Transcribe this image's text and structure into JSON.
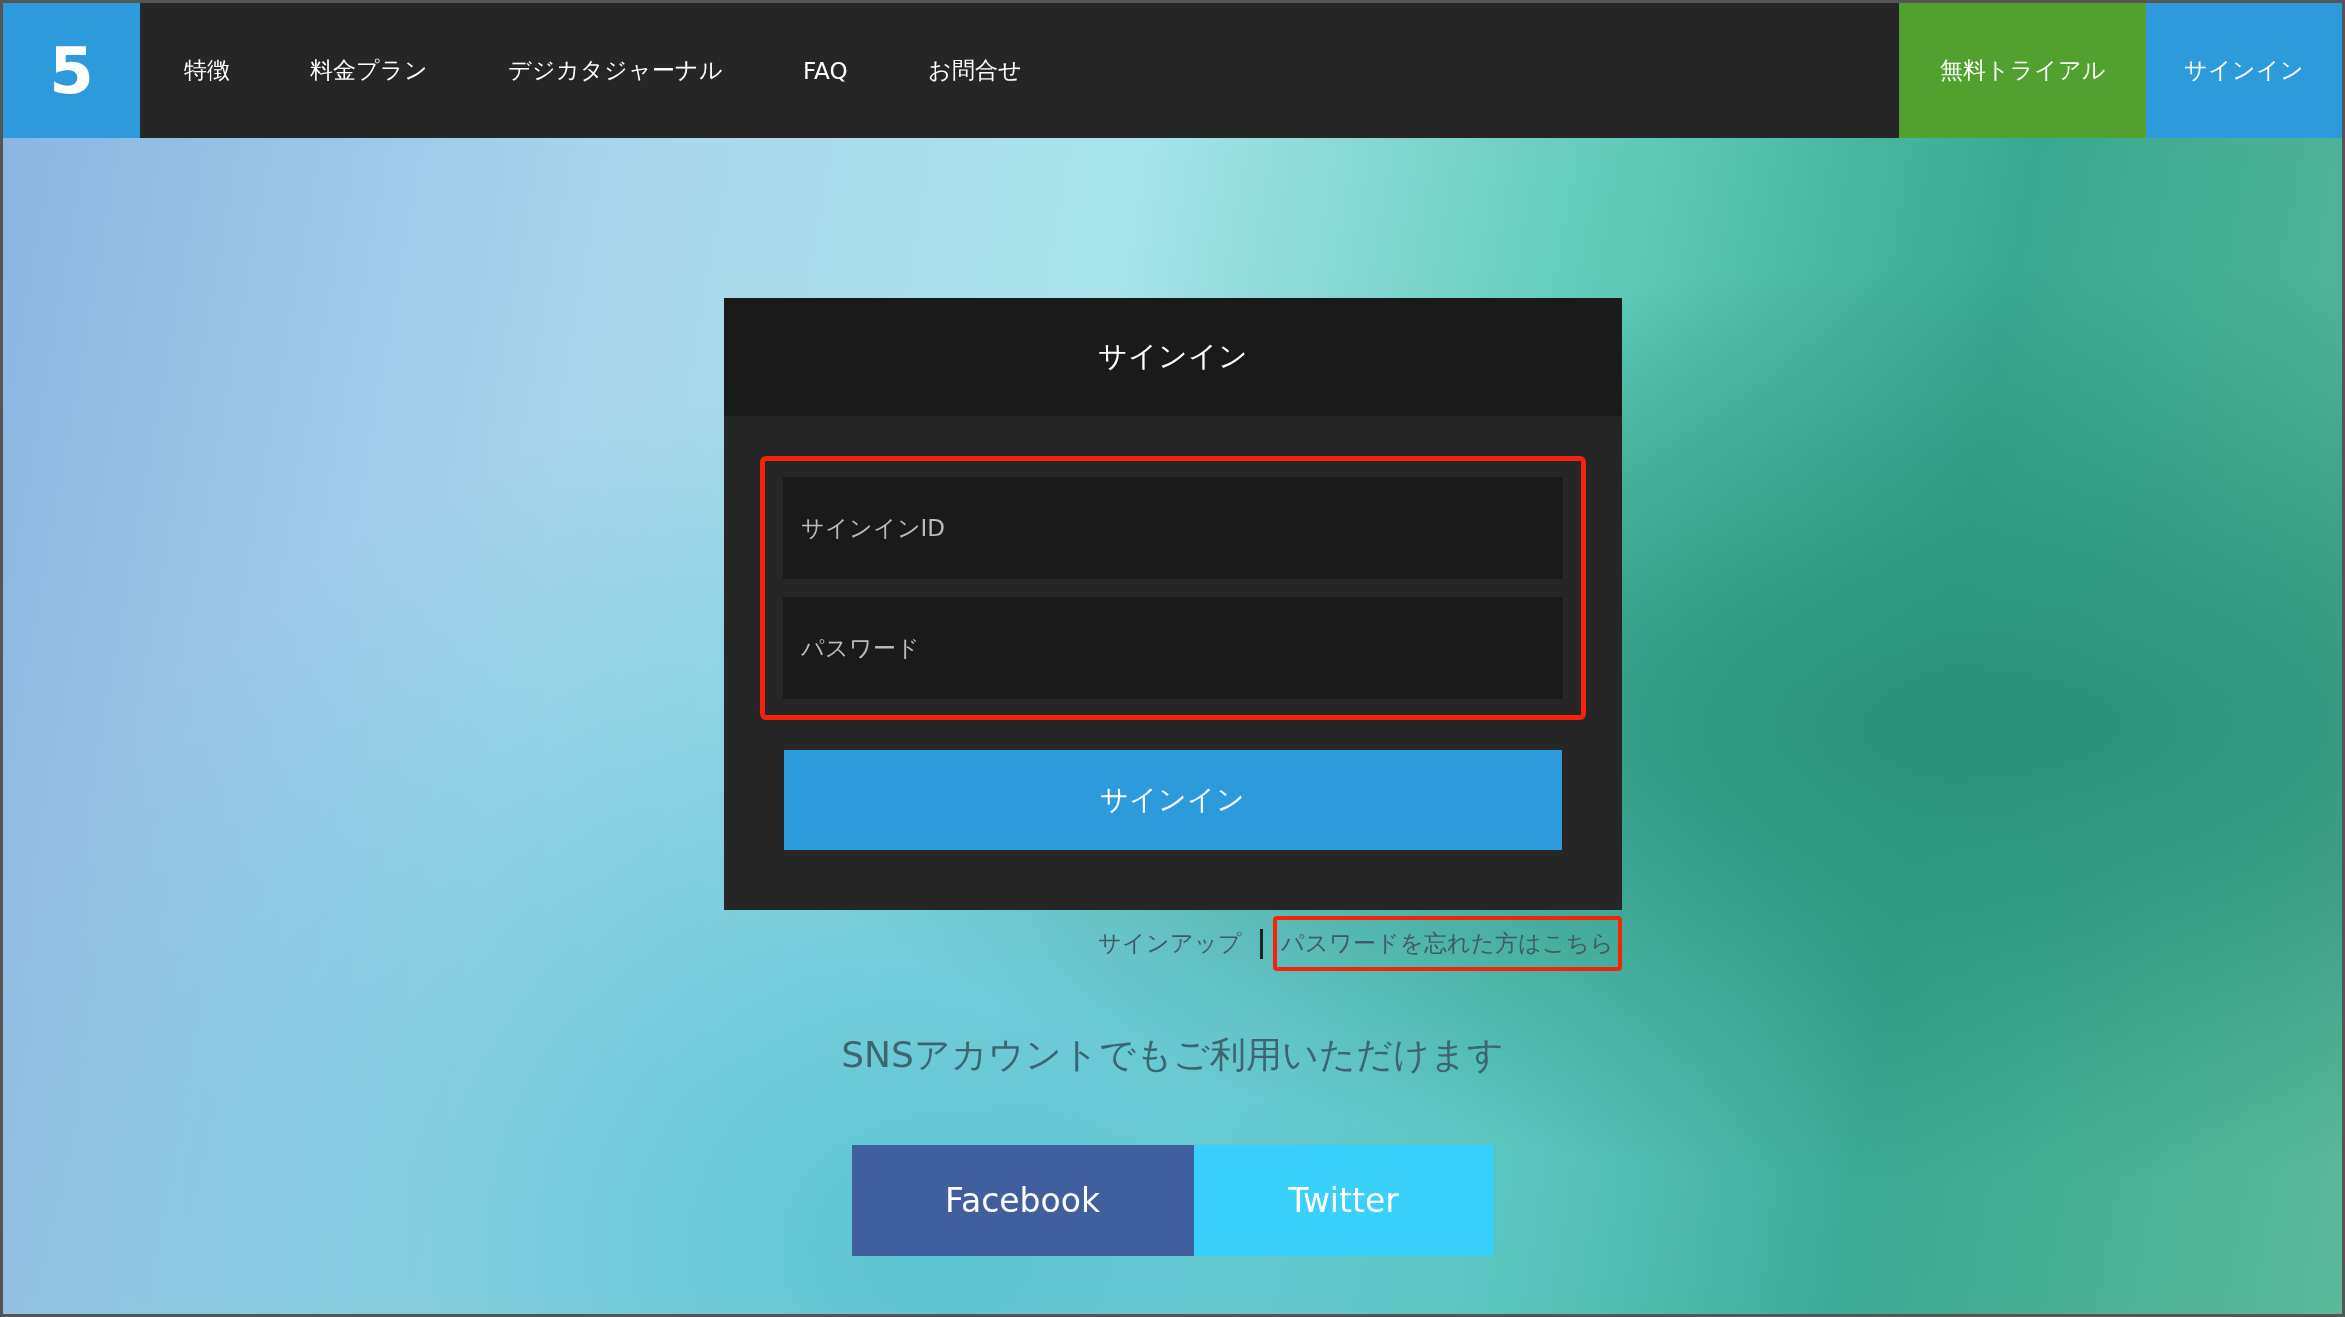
{
  "logo": {
    "text": "5"
  },
  "nav": {
    "items": [
      {
        "label": "特徴"
      },
      {
        "label": "料金プラン"
      },
      {
        "label": "デジカタジャーナル"
      },
      {
        "label": "FAQ"
      },
      {
        "label": "お問合せ"
      }
    ],
    "trial_button": "無料トライアル",
    "signin_button": "サインイン"
  },
  "signin_card": {
    "title": "サインイン",
    "fields_highlighted": true,
    "fields": [
      {
        "placeholder": "サインインID"
      },
      {
        "placeholder": "パスワード"
      }
    ],
    "submit": "サインイン"
  },
  "links": [
    {
      "label": "サインアップ",
      "highlighted": false
    },
    {
      "label": "パスワードを忘れた方はこちら",
      "highlighted": true
    }
  ],
  "sns": {
    "heading": "SNSアカウントでもご利用いただけます",
    "buttons": [
      {
        "label": "Facebook",
        "kind": "facebook"
      },
      {
        "label": "Twitter",
        "kind": "twitter"
      }
    ]
  }
}
